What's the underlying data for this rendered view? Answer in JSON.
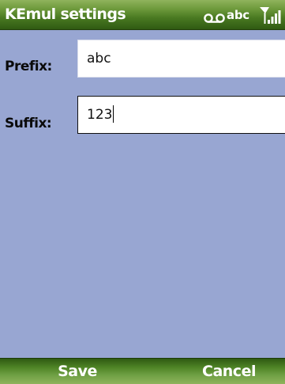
{
  "window": {
    "title": "KEmul settings"
  },
  "status": {
    "voicemail_icon": "voicemail-icon",
    "input_mode": "abc",
    "signal_icon": "signal-strength-icon"
  },
  "form": {
    "prefix": {
      "label": "Prefix:",
      "value": "abc"
    },
    "suffix": {
      "label": "Suffix:",
      "value": "123"
    }
  },
  "softkeys": {
    "left": "Save",
    "right": "Cancel"
  },
  "colors": {
    "titlebar": "#4a7a22",
    "content_background": "#98a6d2",
    "field_background": "#ffffff",
    "label_text": "#0a0a0a",
    "softkey_text": "#ffffff"
  }
}
